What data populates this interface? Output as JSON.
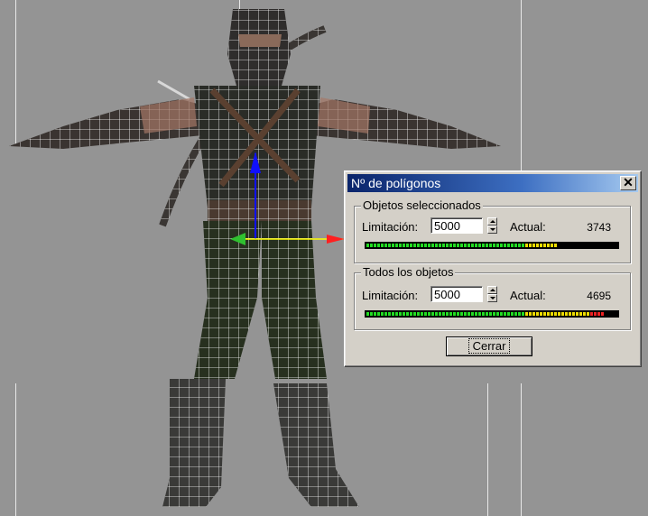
{
  "dialog": {
    "title": "Nº de polígonos",
    "close_glyph": "✕",
    "selected": {
      "group_title": "Objetos seleccionados",
      "limit_label": "Limitación:",
      "limit_value": "5000",
      "actual_label": "Actual:",
      "actual_value": "3743",
      "meter_fraction": 0.75
    },
    "all": {
      "group_title": "Todos los objetos",
      "limit_label": "Limitación:",
      "limit_value": "5000",
      "actual_label": "Actual:",
      "actual_value": "4695",
      "meter_fraction": 0.94
    },
    "close_button": "Cerrar"
  },
  "colors": {
    "meter_green": "#22dd22",
    "meter_yellow": "#eedd00",
    "meter_red": "#ee2222",
    "title_bar": "#0a246a"
  },
  "icons": {
    "close": "close-icon",
    "spin_up": "spin-up-icon",
    "spin_down": "spin-down-icon"
  }
}
